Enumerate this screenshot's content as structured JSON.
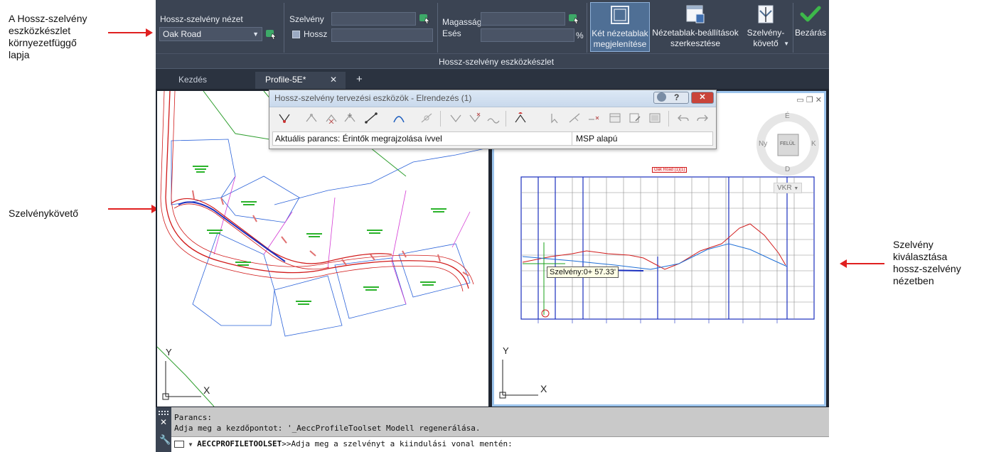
{
  "annotations": {
    "contextual_tab": [
      "A Hossz-szelvény",
      "eszközkészlet",
      "környezetfüggő",
      "lapja"
    ],
    "station_tracker": [
      "Szelvénykövető"
    ],
    "select_station": [
      "Szelvény",
      "kiválasztása",
      "hossz-szelvény",
      "nézetben"
    ]
  },
  "ribbon": {
    "profile_view_label": "Hossz-szelvény nézet",
    "profile_view_value": "Oak Road",
    "station_label": "Szelvény",
    "length_label": "Hossz",
    "elevation_label": "Magasság",
    "grade_label": "Esés",
    "grade_unit": "%",
    "station_value": "",
    "length_value": "",
    "elevation_value": "",
    "grade_value": "",
    "panel_title": "Hossz-szelvény eszközkészlet",
    "btn_two_viewports": [
      "Két nézetablak",
      "megjelenítése"
    ],
    "btn_viewport_settings": [
      "Nézetablak-beállítások",
      "szerkesztése"
    ],
    "btn_station_tracker": [
      "Szelvény-",
      "követő"
    ],
    "btn_close": "Bezárás"
  },
  "tabs": {
    "start": "Kezdés",
    "drawing": "Profile-5E*",
    "close_glyph": "✕",
    "add_glyph": "+"
  },
  "profile_toolbar": {
    "title": "Hossz-szelvény tervezési eszközök - Elrendezés (1)",
    "current_command_label": "Aktuális parancs: Érintők megrajzolása ívvel",
    "mode": "MSP alapú"
  },
  "viewcube": {
    "top": "FELÜL",
    "north": "É",
    "south": "D",
    "east": "K",
    "west": "Ny",
    "wcs": "VKR"
  },
  "profile_view": {
    "title": "Oak Road (1)(1)",
    "station_tooltip": "Szelvény:0+ 57.33'"
  },
  "ucs": {
    "y": "Y",
    "x": "X"
  },
  "command_line": {
    "history": [
      "Parancs:",
      "Adja meg a kezdőpontot: '_AeccProfileToolset Modell regenerálása."
    ],
    "command_name": "AECCPROFILETOOLSET",
    "prompt": ">>Adja meg a szelvényt a kiindulási vonal mentén:"
  },
  "colors": {
    "ribbon_bg": "#3b4453",
    "annotation_arrow": "#e02020",
    "close_check": "#3db84a",
    "profile_ground": "#d11a1a",
    "profile_design": "#1f6fd6"
  }
}
